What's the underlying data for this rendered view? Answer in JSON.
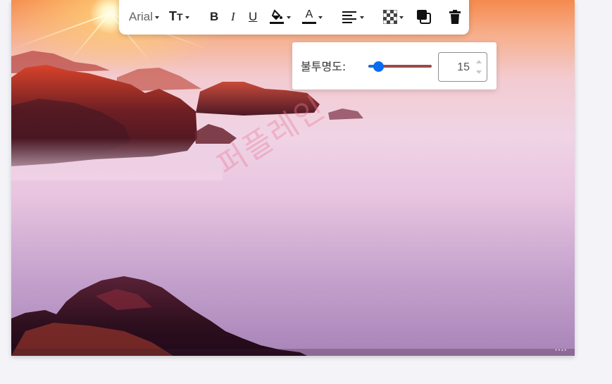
{
  "toolbar": {
    "font_family": "Arial",
    "font_size_glyph_big": "T",
    "font_size_glyph_small": "T",
    "bold": "B",
    "italic": "I",
    "underline": "U",
    "text_color_glyph": "A",
    "icons": {
      "fill": "paint-bucket-icon",
      "text_color": "text-color-icon",
      "align": "align-left-icon",
      "transparency": "checkerboard-icon",
      "layer": "layer-order-icon",
      "delete": "trash-icon"
    }
  },
  "opacity_panel": {
    "label": "불투명도:",
    "value": "15",
    "slider_fraction": 0.15
  },
  "canvas": {
    "watermark": "퍼플레인",
    "corner_mark": "• • ▪ •"
  },
  "colors": {
    "slider_thumb": "#0a6cf0",
    "slider_track": "#9b4a4a",
    "toolbar_bg": "#ffffff"
  }
}
